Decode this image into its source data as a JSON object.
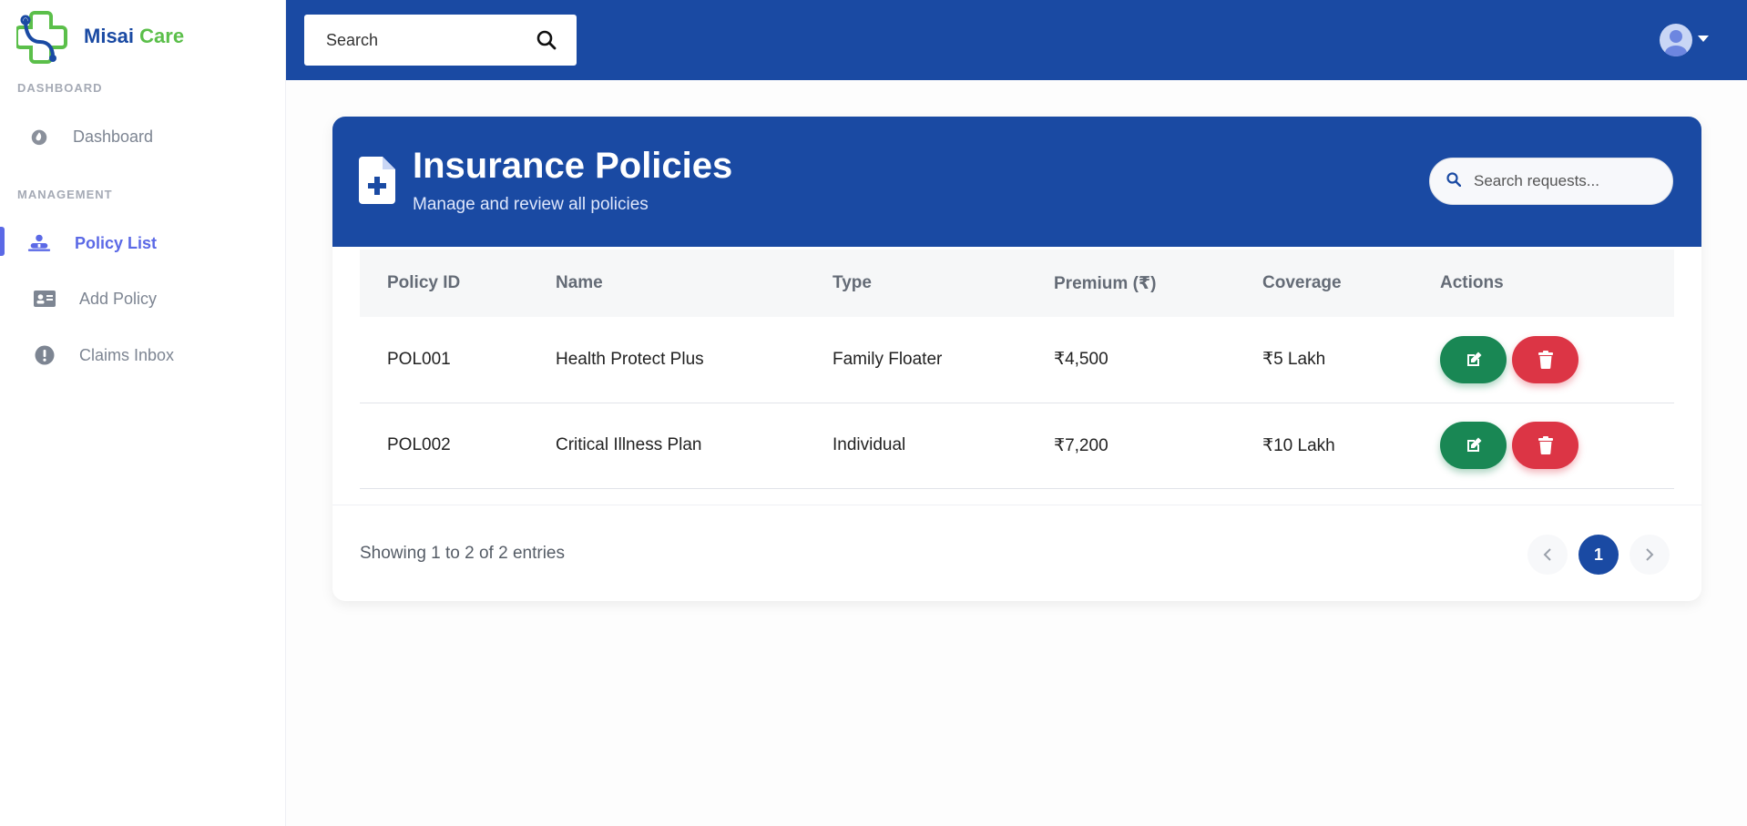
{
  "brand": {
    "name_part1": "Misai",
    "name_part2": "Care"
  },
  "sidebar": {
    "section_dashboard": "DASHBOARD",
    "section_management": "MANAGEMENT",
    "items": [
      {
        "label": "Dashboard",
        "icon": "flame-icon"
      },
      {
        "label": "Policy List",
        "icon": "patient-icon",
        "active": true
      },
      {
        "label": "Add Policy",
        "icon": "id-card-icon"
      },
      {
        "label": "Claims Inbox",
        "icon": "alert-circle-icon"
      }
    ]
  },
  "topbar": {
    "search_placeholder": "Search"
  },
  "card": {
    "title": "Insurance Policies",
    "subtitle": "Manage and review all policies",
    "search_placeholder": "Search requests..."
  },
  "table": {
    "headers": [
      "Policy ID",
      "Name",
      "Type",
      "Premium (₹)",
      "Coverage",
      "Actions"
    ],
    "rows": [
      [
        "POL001",
        "Health Protect Plus",
        "Family Floater",
        "₹4,500",
        "₹5 Lakh"
      ],
      [
        "POL002",
        "Critical Illness Plan",
        "Individual",
        "₹7,200",
        "₹10 Lakh"
      ]
    ]
  },
  "footer": {
    "showing": "Showing 1 to 2 of 2 entries",
    "current_page": "1"
  },
  "colors": {
    "primary": "#1a4aa3",
    "brand_green": "#5bbf4a",
    "edit": "#198754",
    "delete": "#dc3545",
    "active_nav": "#5b69e6"
  }
}
